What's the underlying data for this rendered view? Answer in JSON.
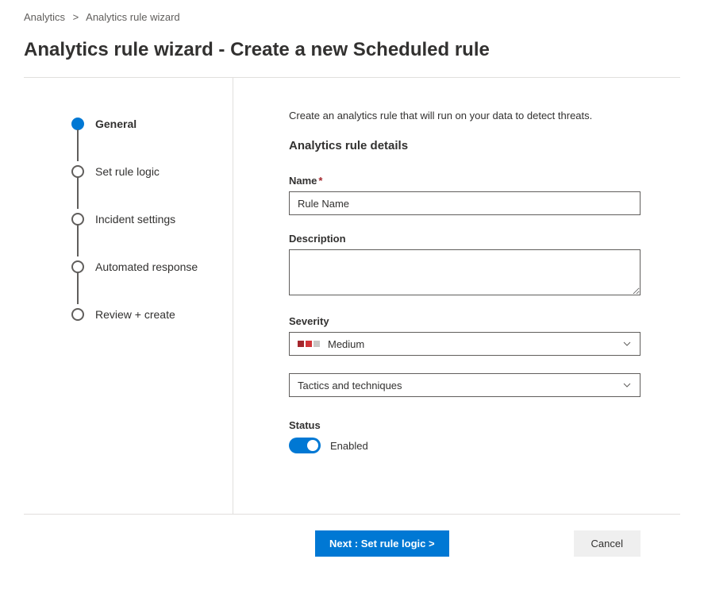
{
  "breadcrumb": {
    "parent": "Analytics",
    "current": "Analytics rule wizard"
  },
  "page_title": "Analytics rule wizard - Create a new Scheduled rule",
  "sidebar": {
    "steps": [
      {
        "label": "General",
        "active": true
      },
      {
        "label": "Set rule logic",
        "active": false
      },
      {
        "label": "Incident settings",
        "active": false
      },
      {
        "label": "Automated response",
        "active": false
      },
      {
        "label": "Review + create",
        "active": false
      }
    ]
  },
  "main": {
    "intro": "Create an analytics rule that will run on your data to detect threats.",
    "section_title": "Analytics rule details",
    "fields": {
      "name": {
        "label": "Name",
        "required": true,
        "value": "Rule Name"
      },
      "description": {
        "label": "Description",
        "value": ""
      },
      "severity": {
        "label": "Severity",
        "selected": "Medium"
      },
      "tactics": {
        "placeholder": "Tactics and techniques"
      },
      "status": {
        "label": "Status",
        "value_label": "Enabled",
        "enabled": true
      }
    }
  },
  "footer": {
    "next_label": "Next : Set rule logic >",
    "cancel_label": "Cancel"
  }
}
